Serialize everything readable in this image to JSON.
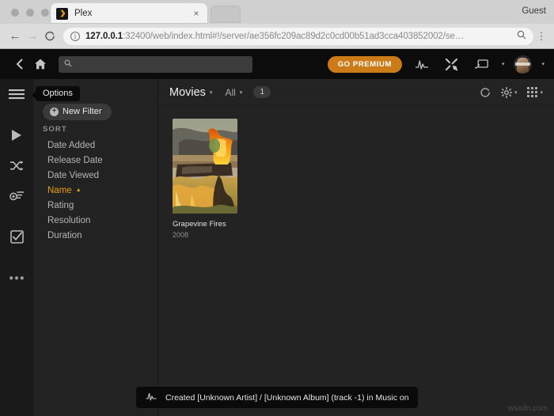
{
  "browser": {
    "tab": {
      "title": "Plex",
      "favicon": "plex-logo-icon",
      "close": "×"
    },
    "profile_label": "Guest",
    "nav": {
      "back": "←",
      "forward": "→",
      "reload": "⟳",
      "menu": "⋮"
    },
    "omnibox": {
      "info_icon": "info-circle-icon",
      "url_host": "127.0.0.1",
      "url_rest": ":32400/web/index.html#!/server/ae356fc209ac89d2c0cd00b51ad3cca403852002/se…",
      "zoom_icon": "zoom-search-icon"
    }
  },
  "plex": {
    "topbar": {
      "back_icon": "chevron-left-icon",
      "home_icon": "home-icon",
      "search_placeholder": "",
      "search_value": "",
      "search_icon": "magnifier-icon",
      "go_premium_label": "GO PREMIUM",
      "activity_icon": "activity-pulse-icon",
      "tools_icon": "wrench-screwdriver-icon",
      "cast_icon": "cast-screen-icon",
      "avatar_icon": "user-avatar",
      "caret": "▾"
    },
    "rail": [
      {
        "name": "hamburger-menu",
        "icon": "hamburger-icon"
      },
      {
        "name": "play",
        "icon": "play-icon"
      },
      {
        "name": "shuffle",
        "icon": "shuffle-icon"
      },
      {
        "name": "add-to-playlist",
        "icon": "playlist-add-icon"
      },
      {
        "name": "mark-watched",
        "icon": "checkbox-check-icon"
      },
      {
        "name": "more-options",
        "icon": "ellipsis-icon"
      }
    ],
    "options": {
      "tooltip": "Options",
      "new_filter_label": "New Filter",
      "new_filter_icon": "plus-circle-icon",
      "sort_heading": "SORT",
      "sort_items": [
        {
          "label": "Date Added",
          "active": false,
          "arrow": ""
        },
        {
          "label": "Release Date",
          "active": false,
          "arrow": ""
        },
        {
          "label": "Date Viewed",
          "active": false,
          "arrow": ""
        },
        {
          "label": "Name",
          "active": true,
          "arrow": "▲"
        },
        {
          "label": "Rating",
          "active": false,
          "arrow": ""
        },
        {
          "label": "Resolution",
          "active": false,
          "arrow": ""
        },
        {
          "label": "Duration",
          "active": false,
          "arrow": ""
        }
      ]
    },
    "content_header": {
      "library_label": "Movies",
      "library_caret": "▾",
      "filter_label": "All",
      "filter_caret": "▾",
      "count": "1",
      "refresh_icon": "refresh-icon",
      "settings_icon": "gear-icon",
      "settings_caret": "▾",
      "layout_icon": "grid-layout-icon",
      "layout_caret": "▾"
    },
    "items": [
      {
        "title": "Grapevine Fires",
        "year": "2008",
        "poster": "wildfire-burning-house-artwork"
      }
    ],
    "toast": {
      "icon": "activity-pulse-icon",
      "text": "Created [Unknown Artist] / [Unknown Album] (track -1) in Music on"
    }
  },
  "watermark": "wsxdn.com",
  "colors": {
    "plex_accent": "#e5a00d",
    "premium_button": "#cc7b19",
    "app_bg": "#232323",
    "rail_bg": "#1a1a1a",
    "panel_bg": "#222222",
    "topbar_bg": "#0c0c0c"
  }
}
